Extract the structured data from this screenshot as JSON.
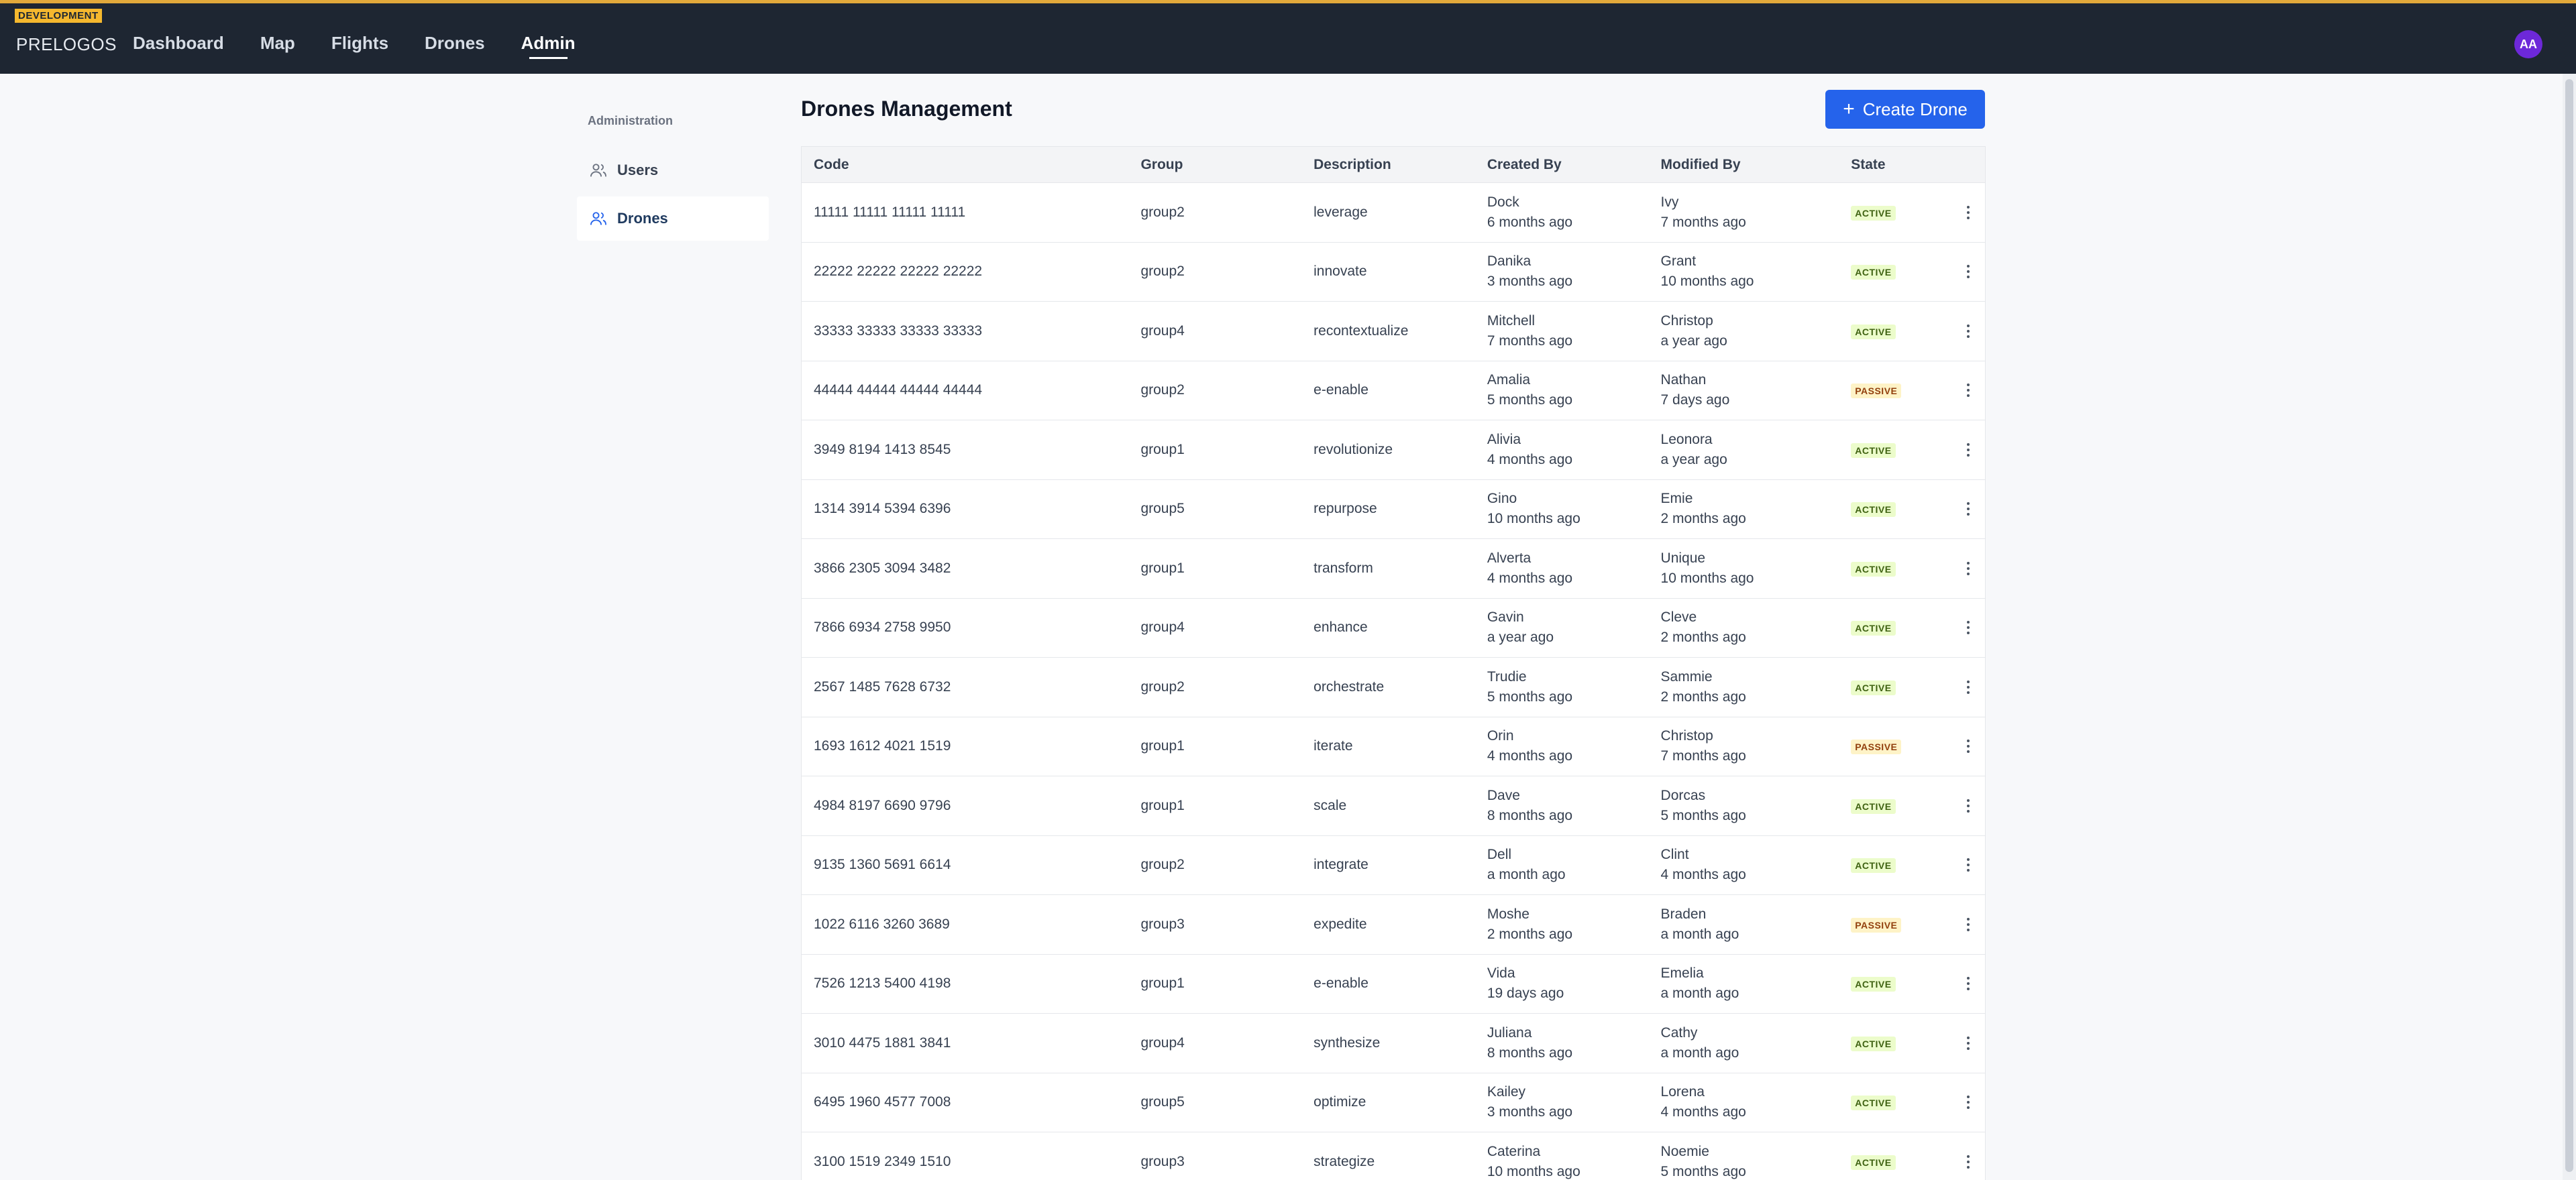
{
  "env_badge": "DEVELOPMENT",
  "brand": "PRELOGOS",
  "nav": [
    {
      "label": "Dashboard",
      "active": false
    },
    {
      "label": "Map",
      "active": false
    },
    {
      "label": "Flights",
      "active": false
    },
    {
      "label": "Drones",
      "active": false
    },
    {
      "label": "Admin",
      "active": true
    }
  ],
  "user": {
    "initials": "AA"
  },
  "sidebar": {
    "heading": "Administration",
    "items": [
      {
        "label": "Users",
        "icon": "users-icon",
        "active": false
      },
      {
        "label": "Drones",
        "icon": "users-icon",
        "active": true
      }
    ]
  },
  "page": {
    "title": "Drones Management",
    "create_label": "Create Drone"
  },
  "table": {
    "columns": [
      "Code",
      "Group",
      "Description",
      "Created By",
      "Modified By",
      "State"
    ],
    "rows": [
      {
        "code": "11111 11111 11111 11111",
        "group": "group2",
        "description": "leverage",
        "created_by": "Dock",
        "created_at": "6 months ago",
        "modified_by": "Ivy",
        "modified_at": "7 months ago",
        "state": "ACTIVE"
      },
      {
        "code": "22222 22222 22222 22222",
        "group": "group2",
        "description": "innovate",
        "created_by": "Danika",
        "created_at": "3 months ago",
        "modified_by": "Grant",
        "modified_at": "10 months ago",
        "state": "ACTIVE"
      },
      {
        "code": "33333 33333 33333 33333",
        "group": "group4",
        "description": "recontextualize",
        "created_by": "Mitchell",
        "created_at": "7 months ago",
        "modified_by": "Christop",
        "modified_at": "a year ago",
        "state": "ACTIVE"
      },
      {
        "code": "44444 44444 44444 44444",
        "group": "group2",
        "description": "e-enable",
        "created_by": "Amalia",
        "created_at": "5 months ago",
        "modified_by": "Nathan",
        "modified_at": "7 days ago",
        "state": "PASSIVE"
      },
      {
        "code": "3949 8194 1413 8545",
        "group": "group1",
        "description": "revolutionize",
        "created_by": "Alivia",
        "created_at": "4 months ago",
        "modified_by": "Leonora",
        "modified_at": "a year ago",
        "state": "ACTIVE"
      },
      {
        "code": "1314 3914 5394 6396",
        "group": "group5",
        "description": "repurpose",
        "created_by": "Gino",
        "created_at": "10 months ago",
        "modified_by": "Emie",
        "modified_at": "2 months ago",
        "state": "ACTIVE"
      },
      {
        "code": "3866 2305 3094 3482",
        "group": "group1",
        "description": "transform",
        "created_by": "Alverta",
        "created_at": "4 months ago",
        "modified_by": "Unique",
        "modified_at": "10 months ago",
        "state": "ACTIVE"
      },
      {
        "code": "7866 6934 2758 9950",
        "group": "group4",
        "description": "enhance",
        "created_by": "Gavin",
        "created_at": "a year ago",
        "modified_by": "Cleve",
        "modified_at": "2 months ago",
        "state": "ACTIVE"
      },
      {
        "code": "2567 1485 7628 6732",
        "group": "group2",
        "description": "orchestrate",
        "created_by": "Trudie",
        "created_at": "5 months ago",
        "modified_by": "Sammie",
        "modified_at": "2 months ago",
        "state": "ACTIVE"
      },
      {
        "code": "1693 1612 4021 1519",
        "group": "group1",
        "description": "iterate",
        "created_by": "Orin",
        "created_at": "4 months ago",
        "modified_by": "Christop",
        "modified_at": "7 months ago",
        "state": "PASSIVE"
      },
      {
        "code": "4984 8197 6690 9796",
        "group": "group1",
        "description": "scale",
        "created_by": "Dave",
        "created_at": "8 months ago",
        "modified_by": "Dorcas",
        "modified_at": "5 months ago",
        "state": "ACTIVE"
      },
      {
        "code": "9135 1360 5691 6614",
        "group": "group2",
        "description": "integrate",
        "created_by": "Dell",
        "created_at": "a month ago",
        "modified_by": "Clint",
        "modified_at": "4 months ago",
        "state": "ACTIVE"
      },
      {
        "code": "1022 6116 3260 3689",
        "group": "group3",
        "description": "expedite",
        "created_by": "Moshe",
        "created_at": "2 months ago",
        "modified_by": "Braden",
        "modified_at": "a month ago",
        "state": "PASSIVE"
      },
      {
        "code": "7526 1213 5400 4198",
        "group": "group1",
        "description": "e-enable",
        "created_by": "Vida",
        "created_at": "19 days ago",
        "modified_by": "Emelia",
        "modified_at": "a month ago",
        "state": "ACTIVE"
      },
      {
        "code": "3010 4475 1881 3841",
        "group": "group4",
        "description": "synthesize",
        "created_by": "Juliana",
        "created_at": "8 months ago",
        "modified_by": "Cathy",
        "modified_at": "a month ago",
        "state": "ACTIVE"
      },
      {
        "code": "6495 1960 4577 7008",
        "group": "group5",
        "description": "optimize",
        "created_by": "Kailey",
        "created_at": "3 months ago",
        "modified_by": "Lorena",
        "modified_at": "4 months ago",
        "state": "ACTIVE"
      },
      {
        "code": "3100 1519 2349 1510",
        "group": "group3",
        "description": "strategize",
        "created_by": "Caterina",
        "created_at": "10 months ago",
        "modified_by": "Noemie",
        "modified_at": "5 months ago",
        "state": "ACTIVE"
      }
    ]
  }
}
